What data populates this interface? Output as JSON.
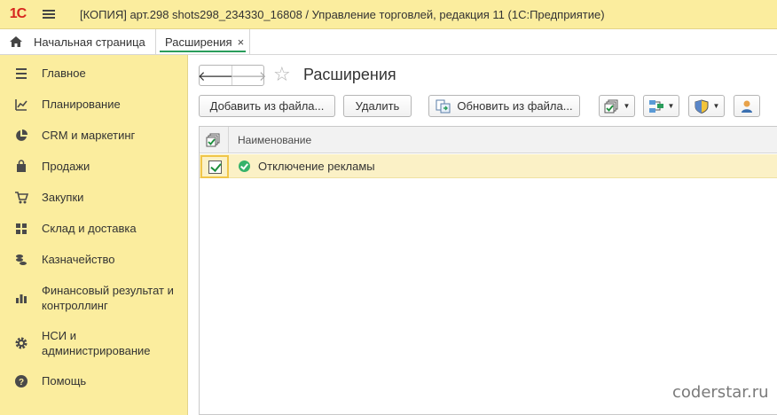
{
  "window": {
    "logo": "1С",
    "title": "[КОПИЯ] арт.298 shots298_234330_16808 / Управление торговлей, редакция 11  (1С:Предприятие)"
  },
  "tabs": [
    {
      "label": "Начальная страница",
      "icon": "home-icon"
    },
    {
      "label": "Расширения",
      "close": "×",
      "active": true
    }
  ],
  "sidebar": {
    "items": [
      {
        "label": "Главное",
        "icon": "menu-lines-icon"
      },
      {
        "label": "Планирование",
        "icon": "planning-icon"
      },
      {
        "label": "CRM и маркетинг",
        "icon": "pie-chart-icon"
      },
      {
        "label": "Продажи",
        "icon": "shopping-bag-icon"
      },
      {
        "label": "Закупки",
        "icon": "cart-icon"
      },
      {
        "label": "Склад и доставка",
        "icon": "grid-icon"
      },
      {
        "label": "Казначейство",
        "icon": "coins-icon"
      },
      {
        "label": "Финансовый результат и контроллинг",
        "icon": "bar-chart-icon"
      },
      {
        "label": "НСИ и администрирование",
        "icon": "gear-icon"
      },
      {
        "label": "Помощь",
        "icon": "help-icon"
      }
    ]
  },
  "page": {
    "title": "Расширения",
    "back": "🡐",
    "forward": "🡒",
    "star": "☆"
  },
  "toolbar": {
    "add_label": "Добавить из файла...",
    "delete_label": "Удалить",
    "update_label": "Обновить из файла...",
    "caret": "▼"
  },
  "table": {
    "column_name": "Наименование",
    "rows": [
      {
        "name": "Отключение рекламы",
        "checked": true
      }
    ]
  },
  "watermark": "coderstar.ru"
}
